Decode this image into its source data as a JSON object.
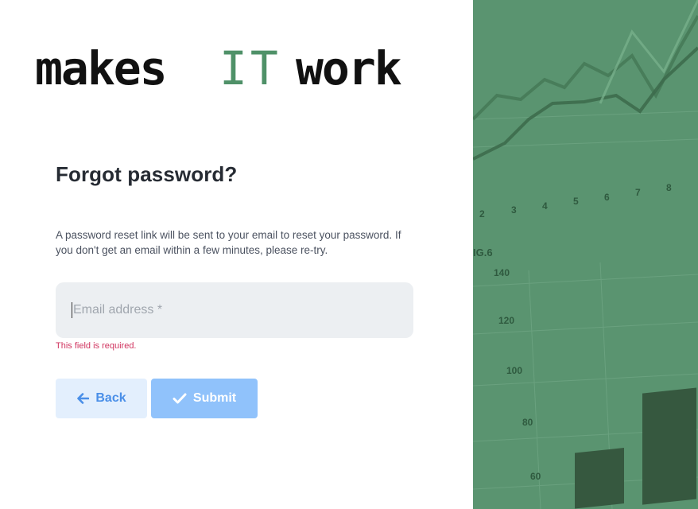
{
  "logo": {
    "part1": "makes",
    "part2": "IT",
    "part3": "work",
    "dark_color": "#111111",
    "accent_color": "#4f9168"
  },
  "form": {
    "title": "Forgot password?",
    "description": "A password reset link will be sent to your email to reset your password. If you don't get an email within a few minutes, please re-try.",
    "email_placeholder": "Email address *",
    "email_value": "",
    "error_text": "This field is required.",
    "back_label": "Back",
    "submit_label": "Submit"
  },
  "background": {
    "label": "IG.6",
    "x_ticks": [
      "2",
      "3",
      "4",
      "5",
      "6",
      "7",
      "8"
    ],
    "y_ticks": [
      "140",
      "120",
      "100",
      "80",
      "60"
    ],
    "panel_color": "#5a9470"
  }
}
